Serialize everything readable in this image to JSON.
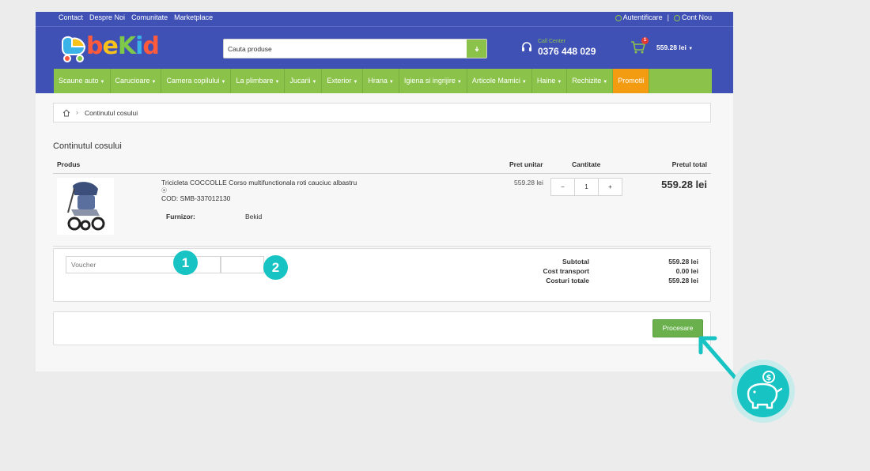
{
  "topbar": {
    "links": [
      "Contact",
      "Despre Noi",
      "Comunitate",
      "Marketplace"
    ],
    "login": "Autentificare",
    "separator": "|",
    "register": "Cont Nou"
  },
  "header": {
    "logo_text": "beKid",
    "search_placeholder": "Cauta produse",
    "call_label": "Call Center",
    "call_number": "0376 448 029",
    "cart_count": "1",
    "cart_total": "559.28 lei"
  },
  "nav": {
    "items": [
      "Scaune auto",
      "Carucioare",
      "Camera copilului",
      "La plimbare",
      "Jucarii",
      "Exterior",
      "Hrana",
      "Igiena si ingrijire",
      "Articole Mamici",
      "Haine",
      "Rechizite"
    ],
    "promo": "Promotii"
  },
  "breadcrumb": {
    "current": "Continutul cosului"
  },
  "page_title": "Continutul cosului",
  "table": {
    "headers": {
      "product": "Produs",
      "unit_price": "Pret unitar",
      "quantity": "Cantitate",
      "total_price": "Pretul total"
    }
  },
  "item": {
    "name": "Tricicleta COCCOLLE Corso multifunctionala roti cauciuc albastru",
    "code": "COD: SMB-337012130",
    "supplier_label": "Furnizor:",
    "supplier": "Bekid",
    "unit_price": "559.28 lei",
    "qty_minus": "−",
    "quantity": "1",
    "qty_plus": "+",
    "total": "559.28 lei"
  },
  "summary": {
    "voucher_placeholder": "Voucher",
    "subtotal_label": "Subtotal",
    "subtotal": "559.28 lei",
    "transport_label": "Cost transport",
    "transport": "0.00 lei",
    "total_label": "Costuri totale",
    "total": "559.28 lei"
  },
  "process_button": "Procesare",
  "markers": [
    "1",
    "2"
  ],
  "colors": {
    "header": "#3f51b5",
    "nav": "#8bc34a",
    "promo": "#f39c12",
    "marker": "#17c3c3",
    "button": "#6ab04c"
  }
}
